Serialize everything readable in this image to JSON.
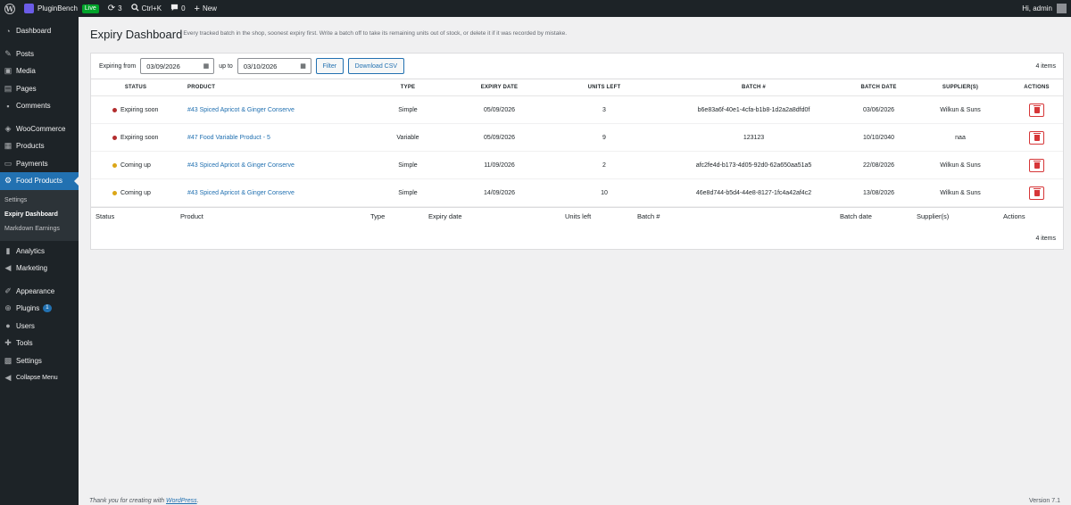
{
  "adminbar": {
    "site_name": "PluginBench",
    "live_badge": "Live",
    "updates_count": "3",
    "search_shortcut": "Ctrl+K",
    "comments_count": "0",
    "new_label": "New",
    "greeting": "Hi, admin"
  },
  "sidebar": {
    "items": [
      {
        "label": "Dashboard",
        "icon": "dashboard-icon"
      },
      {
        "label": "Posts",
        "icon": "pin-icon"
      },
      {
        "label": "Media",
        "icon": "media-icon"
      },
      {
        "label": "Pages",
        "icon": "pages-icon"
      },
      {
        "label": "Comments",
        "icon": "comment-icon"
      },
      {
        "label": "WooCommerce",
        "icon": "woo-icon"
      },
      {
        "label": "Products",
        "icon": "archive-icon"
      },
      {
        "label": "Payments",
        "icon": "payments-icon"
      },
      {
        "label": "Food Products",
        "icon": "gear-icon"
      },
      {
        "label": "Analytics",
        "icon": "chart-icon"
      },
      {
        "label": "Marketing",
        "icon": "megaphone-icon"
      },
      {
        "label": "Appearance",
        "icon": "brush-icon"
      },
      {
        "label": "Plugins",
        "icon": "plugin-icon",
        "badge": "1"
      },
      {
        "label": "Users",
        "icon": "users-icon"
      },
      {
        "label": "Tools",
        "icon": "wrench-icon"
      },
      {
        "label": "Settings",
        "icon": "settings-icon"
      },
      {
        "label": "Collapse Menu",
        "icon": "collapse-icon"
      }
    ],
    "submenu": [
      "Settings",
      "Expiry Dashboard",
      "Markdown Earnings"
    ]
  },
  "page": {
    "title": "Expiry Dashboard",
    "description": "Every tracked batch in the shop, soonest expiry first. Write a batch off to take its remaining units out of stock, or delete it if it was recorded by mistake."
  },
  "filters": {
    "from_label": "Expiring from",
    "from_value": "03/09/2026",
    "to_label": "up to",
    "to_value": "03/10/2026",
    "filter_button": "Filter",
    "download_button": "Download CSV",
    "items_count": "4 items"
  },
  "table": {
    "headers": [
      "STATUS",
      "PRODUCT",
      "TYPE",
      "EXPIRY DATE",
      "UNITS LEFT",
      "BATCH #",
      "BATCH DATE",
      "SUPPLIER(S)",
      "ACTIONS"
    ],
    "footer_headers": [
      "Status",
      "Product",
      "Type",
      "Expiry date",
      "Units left",
      "Batch #",
      "Batch date",
      "Supplier(s)",
      "Actions"
    ],
    "rows": [
      {
        "status": "Expiring soon",
        "status_color": "#b32d2e",
        "product": "#43 Spiced Apricot & Ginger Conserve",
        "type": "Simple",
        "expiry": "05/09/2026",
        "units": "3",
        "batch": "b6e83a6f-40e1-4cfa-b1b8-1d2a2a8dfd0f",
        "batch_date": "03/06/2026",
        "supplier": "Wilkun & Suns"
      },
      {
        "status": "Expiring soon",
        "status_color": "#b32d2e",
        "product": "#47 Food Variable Product - 5",
        "type": "Variable",
        "expiry": "05/09/2026",
        "units": "9",
        "batch": "123123",
        "batch_date": "10/10/2040",
        "supplier": "naa"
      },
      {
        "status": "Coming up",
        "status_color": "#dba617",
        "product": "#43 Spiced Apricot & Ginger Conserve",
        "type": "Simple",
        "expiry": "11/09/2026",
        "units": "2",
        "batch": "afc2fe4d-b173-4d05-92d0-62a650aa51a5",
        "batch_date": "22/08/2026",
        "supplier": "Wilkun & Suns"
      },
      {
        "status": "Coming up",
        "status_color": "#dba617",
        "product": "#43 Spiced Apricot & Ginger Conserve",
        "type": "Simple",
        "expiry": "14/09/2026",
        "units": "10",
        "batch": "46e8d744-b5d4-44e8-8127-1fc4a42af4c2",
        "batch_date": "13/08/2026",
        "supplier": "Wilkun & Suns"
      }
    ],
    "bottom_count": "4 items"
  },
  "footer": {
    "thanks_prefix": "Thank you for creating with ",
    "thanks_link": "WordPress",
    "thanks_suffix": ".",
    "version": "Version 7.1"
  }
}
